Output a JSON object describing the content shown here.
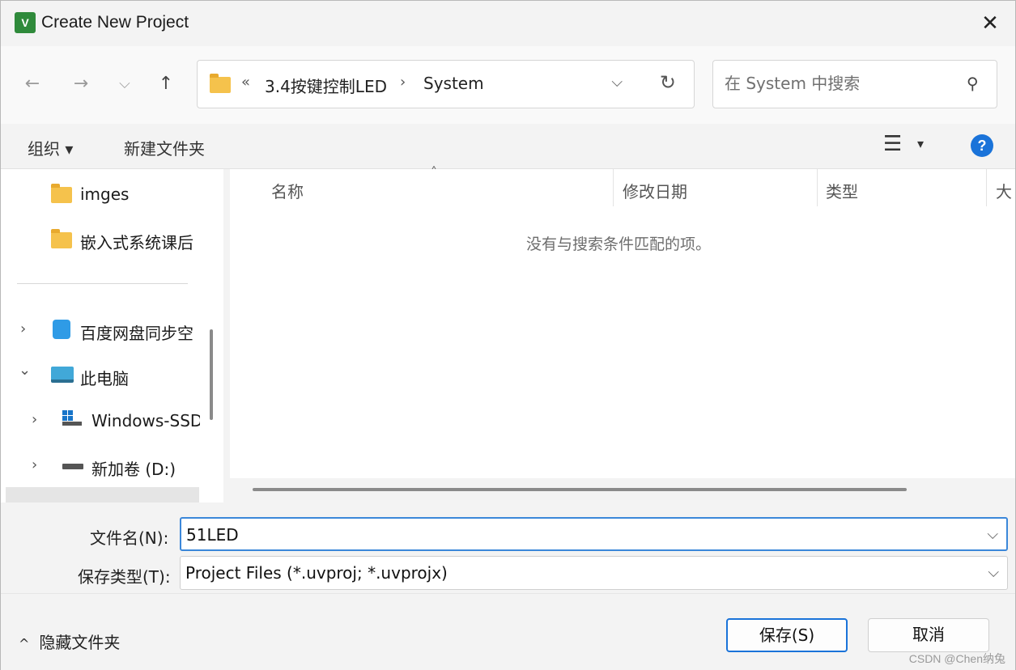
{
  "window": {
    "title": "Create New Project",
    "app_icon_text": "V",
    "close_glyph": "✕"
  },
  "nav": {
    "back_glyph": "←",
    "forward_glyph": "→",
    "recent_glyph": "⌵",
    "up_glyph": "↑",
    "address": {
      "overflow": "«",
      "sep": "›",
      "crumbs": [
        "3.4按键控制LED",
        "System"
      ],
      "dropdown_glyph": "⌵",
      "refresh_glyph": "↻"
    },
    "search": {
      "placeholder": "在 System 中搜索",
      "icon_glyph": "⚲"
    }
  },
  "toolbar": {
    "organize_label": "组织 ▾",
    "new_folder_label": "新建文件夹",
    "view_glyph": "☰",
    "view_dd_glyph": "▾",
    "help_glyph": "?"
  },
  "sidebar": {
    "items": [
      {
        "label": "imges"
      },
      {
        "label": "嵌入式系统课后"
      },
      {
        "label": "百度网盘同步空"
      },
      {
        "label": "此电脑"
      },
      {
        "label": "Windows-SSD"
      },
      {
        "label": "新加卷 (D:)"
      }
    ],
    "collapsed_chevron": "›",
    "expanded_chevron": "⌄"
  },
  "filelist": {
    "columns": [
      "名称",
      "修改日期",
      "类型",
      "大"
    ],
    "sort_glyph": "˄",
    "empty_message": "没有与搜索条件匹配的项。"
  },
  "form": {
    "filename_label": "文件名(N):",
    "filename_value": "51LED",
    "filetype_label": "保存类型(T):",
    "filetype_value": "Project Files (*.uvproj; *.uvprojx)",
    "dropdown_glyph": "⌵"
  },
  "footer": {
    "hide_folders_caret": "^",
    "hide_folders_label": "隐藏文件夹",
    "save_label": "保存(S)",
    "cancel_label": "取消",
    "watermark": "CSDN @Chen纳兔"
  }
}
